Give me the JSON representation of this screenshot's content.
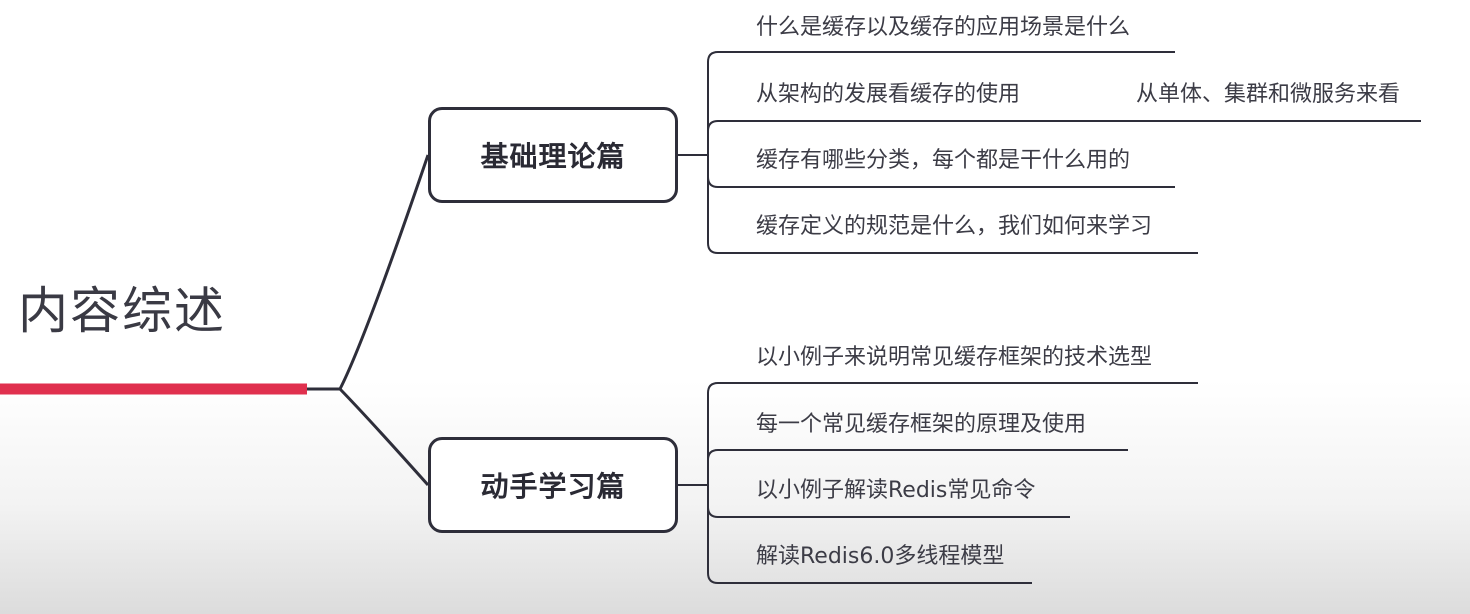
{
  "root": {
    "title": "内容综述",
    "accent_color": "#e0304e"
  },
  "branches": [
    {
      "label": "基础理论篇",
      "items": [
        "什么是缓存以及缓存的应用场景是什么",
        "从架构的发展看缓存的使用",
        "缓存有哪些分类，每个都是干什么用的",
        "缓存定义的规范是什么，我们如何来学习"
      ],
      "notes": [
        {
          "for_item": 1,
          "text": "从单体、集群和微服务来看"
        }
      ]
    },
    {
      "label": "动手学习篇",
      "items": [
        "以小例子来说明常见缓存框架的技术选型",
        "每一个常见缓存框架的原理及使用",
        "以小例子解读Redis常见命令",
        "解读Redis6.0多线程模型"
      ],
      "notes": []
    }
  ]
}
